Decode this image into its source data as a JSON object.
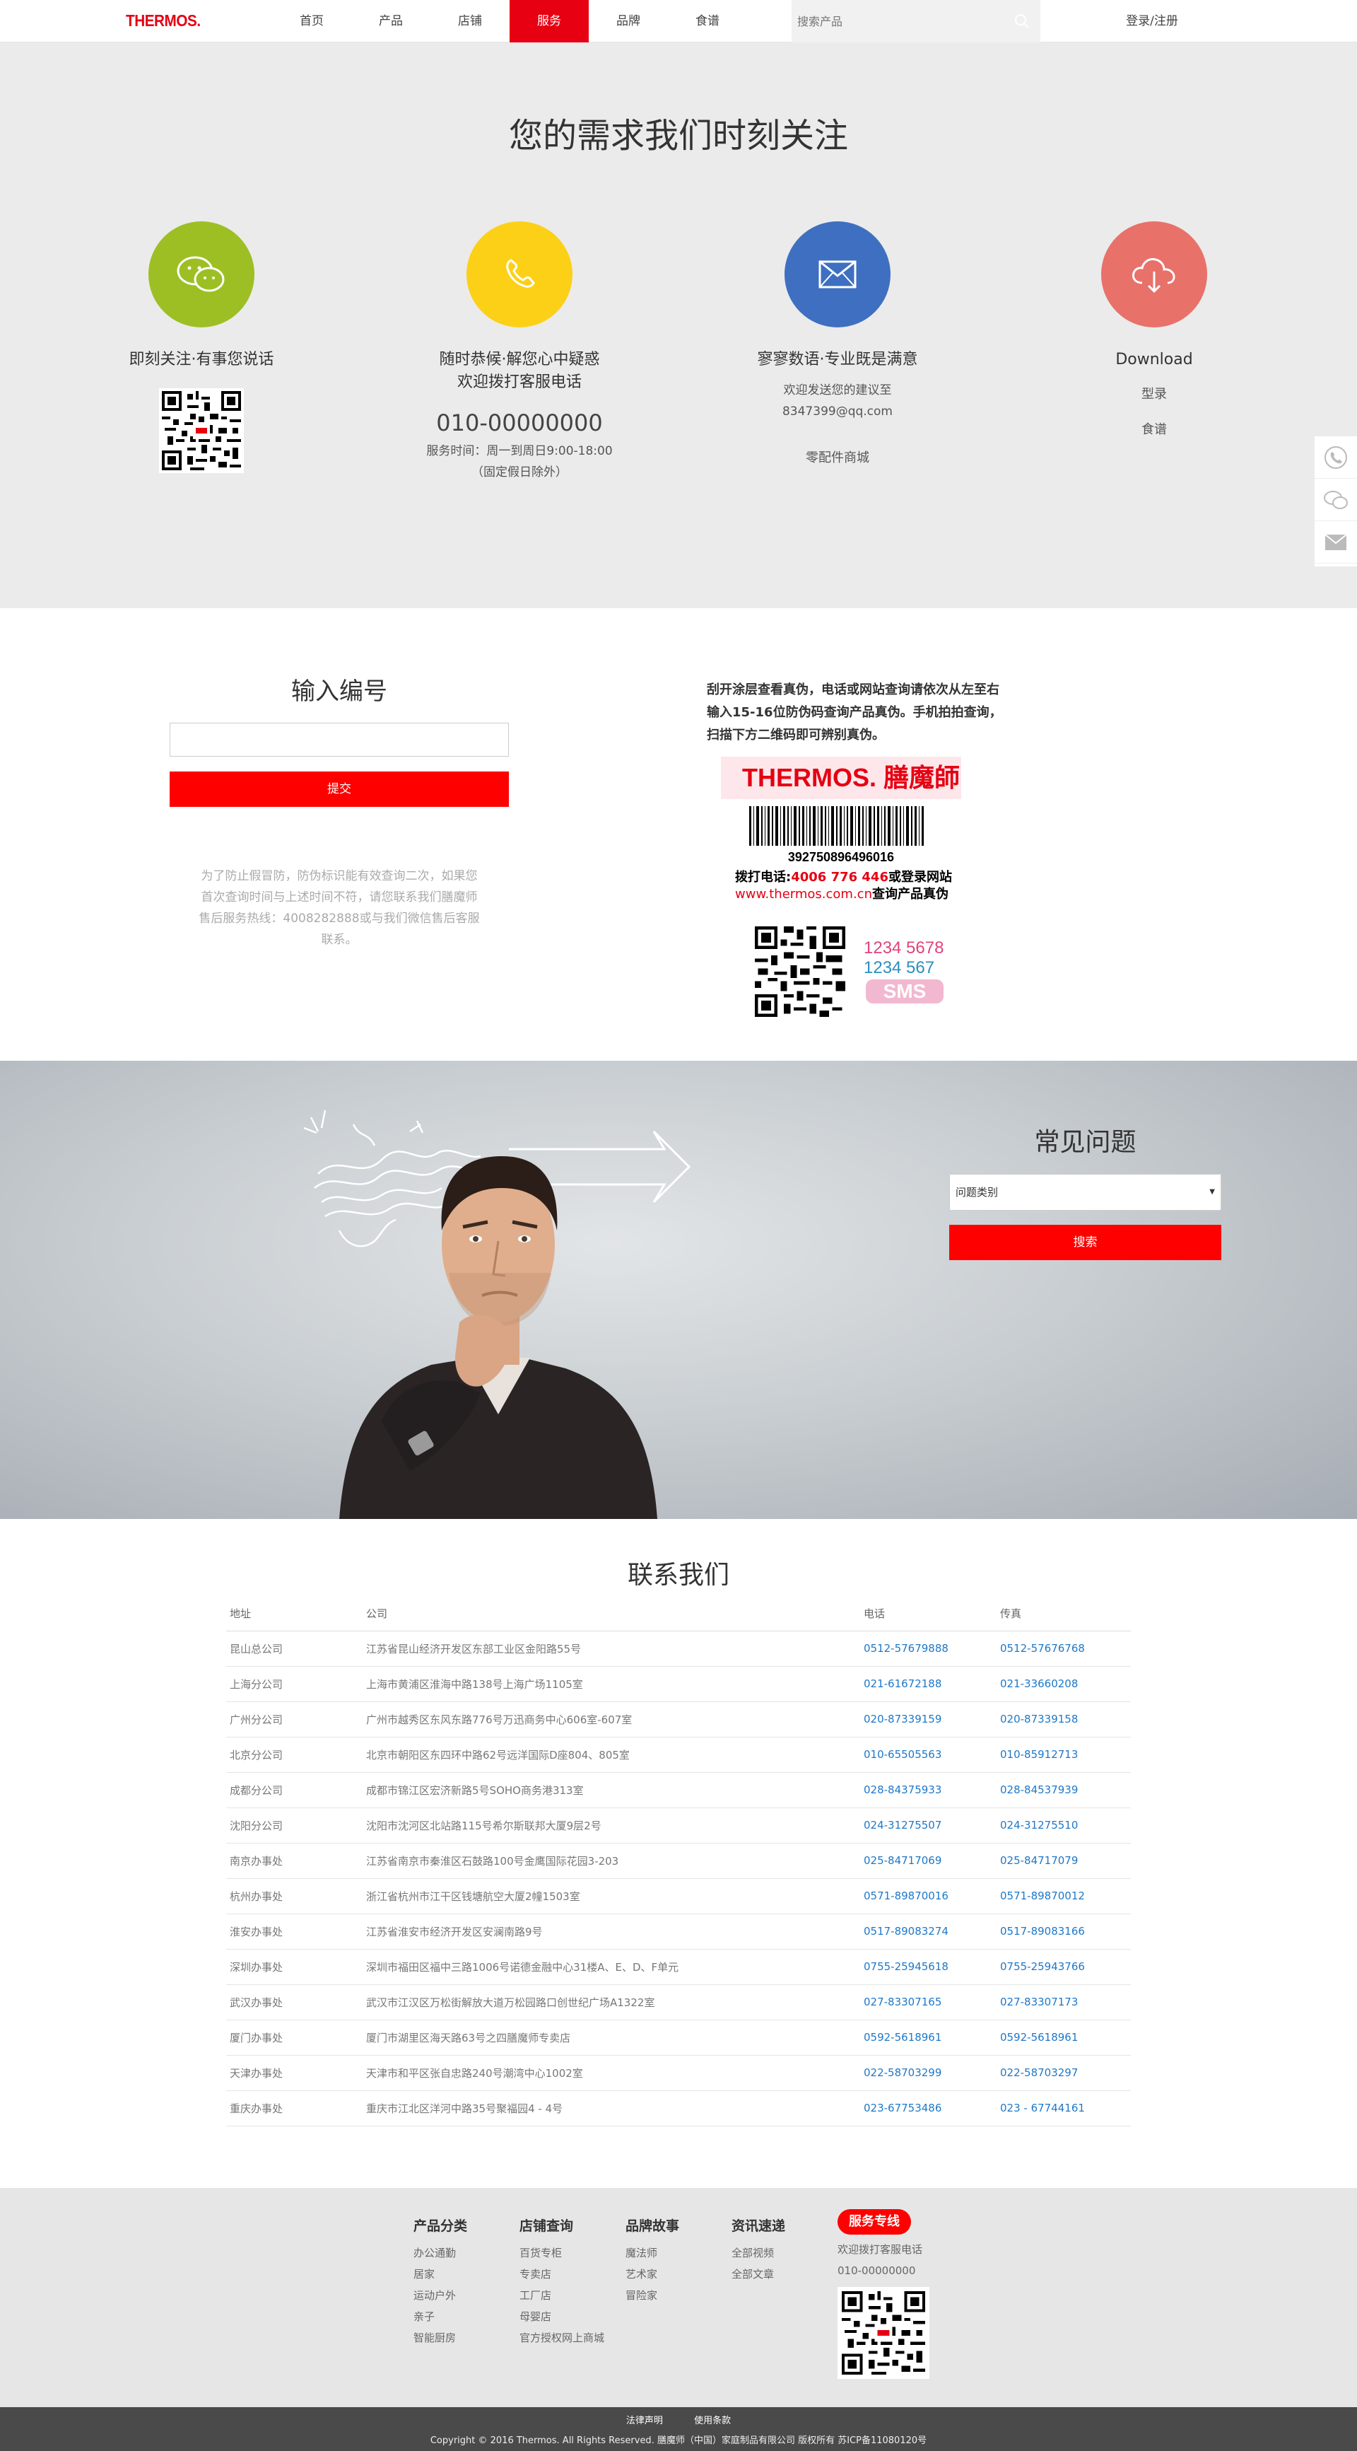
{
  "header": {
    "logo": "THERMOS.",
    "nav": [
      "首页",
      "产品",
      "店铺",
      "服务",
      "品牌",
      "食谱"
    ],
    "active_nav": "服务",
    "search_placeholder": "搜索产品",
    "login_label": "登录/注册"
  },
  "service": {
    "title": "您的需求我们时刻关注",
    "wechat": {
      "heading": "即刻关注·有事您说话",
      "color": "#9dbf24"
    },
    "phone": {
      "heading_line1": "随时恭候·解您心中疑惑",
      "heading_line2": "欢迎拨打客服电话",
      "number": "010-00000000",
      "hours": "服务时间：周一到周日9:00-18:00",
      "hours_note": "（固定假日除外）",
      "color": "#fdd018"
    },
    "mail": {
      "heading": "寥寥数语·专业既是满意",
      "line1": "欢迎发送您的建议至",
      "email": "8347399@qq.com",
      "parts": "零配件商城",
      "color": "#3e6fc1"
    },
    "download": {
      "heading": "Download",
      "link1": "型录",
      "link2": "食谱",
      "color": "#e8716a"
    }
  },
  "verify": {
    "title": "输入编号",
    "input_value": "",
    "submit_label": "提交",
    "note": "为了防止假冒防，防伪标识能有效查询二次，如果您首次查询时间与上述时间不符，请您联系我们膳魔师售后服务热线：4008282888或与我们微信售后客服联系。",
    "instructions": "刮开涂层查看真伪，电话或网站查询请依次从左至右输入15-16位防伪码查询产品真伪。手机拍拍查询，扫描下方二维码即可辨别真伪。",
    "label": {
      "brand": "THERMOS. 膳魔師",
      "barcode_number": "392750896496016",
      "phone_text_prefix": "拨打电话:",
      "phone_number": "4006 776 446",
      "phone_text_suffix": "或登录网站",
      "website": "www.thermos.com.cn",
      "website_suffix": "查询产品真伪",
      "sms_num1": "1234 5678",
      "sms_num2": "1234 567",
      "sms": "SMS"
    }
  },
  "faq": {
    "title": "常见问题",
    "select_value": "问题类别",
    "button_label": "搜索"
  },
  "contact": {
    "title": "联系我们",
    "headers": [
      "地址",
      "公司",
      "电话",
      "传真"
    ],
    "rows": [
      [
        "昆山总公司",
        "江苏省昆山经济开发区东部工业区金阳路55号",
        "0512-57679888",
        "0512-57676768"
      ],
      [
        "上海分公司",
        "上海市黄浦区淮海中路138号上海广场1105室",
        "021-61672188",
        "021-33660208"
      ],
      [
        "广州分公司",
        "广州市越秀区东风东路776号万迅商务中心606室-607室",
        "020-87339159",
        "020-87339158"
      ],
      [
        "北京分公司",
        "北京市朝阳区东四环中路62号远洋国际D座804、805室",
        "010-65505563",
        "010-85912713"
      ],
      [
        "成都分公司",
        "成都市锦江区宏济新路5号SOHO商务港313室",
        "028-84375933",
        "028-84537939"
      ],
      [
        "沈阳分公司",
        "沈阳市沈河区北站路115号希尔斯联邦大厦9层2号",
        "024-31275507",
        "024-31275510"
      ],
      [
        "南京办事处",
        "江苏省南京市秦淮区石鼓路100号金鹰国际花园3-203",
        "025-84717069",
        "025-84717079"
      ],
      [
        "杭州办事处",
        "浙江省杭州市江干区钱塘航空大厦2幢1503室",
        "0571-89870016",
        "0571-89870012"
      ],
      [
        "淮安办事处",
        "江苏省淮安市经济开发区安澜南路9号",
        "0517-89083274",
        "0517-89083166"
      ],
      [
        "深圳办事处",
        "深圳市福田区福中三路1006号诺德金融中心31楼A、E、D、F单元",
        "0755-25945618",
        "0755-25943766"
      ],
      [
        "武汉办事处",
        "武汉市江汉区万松街解放大道万松园路口创世纪广场A1322室",
        "027-83307165",
        "027-83307173"
      ],
      [
        "厦门办事处",
        "厦门市湖里区海天路63号之四膳魔师专卖店",
        "0592-5618961",
        "0592-5618961"
      ],
      [
        "天津办事处",
        "天津市和平区张自忠路240号潮湾中心1002室",
        "022-58703299",
        "022-58703297"
      ],
      [
        "重庆办事处",
        "重庆市江北区洋河中路35号聚福园4 - 4号",
        "023-67753486",
        "023 - 67744161"
      ]
    ]
  },
  "footer": {
    "col1": {
      "heading": "产品分类",
      "links": [
        "办公通勤",
        "居家",
        "运动户外",
        "亲子",
        "智能厨房"
      ]
    },
    "col2": {
      "heading": "店铺查询",
      "links": [
        "百货专柜",
        "专卖店",
        "工厂店",
        "母婴店",
        "官方授权网上商城"
      ]
    },
    "col3": {
      "heading": "品牌故事",
      "links": [
        "魔法师",
        "艺术家",
        "冒险家"
      ]
    },
    "col4": {
      "heading": "资讯速递",
      "links": [
        "全部视频",
        "全部文章"
      ]
    },
    "hotline": {
      "badge": "服务专线",
      "line1": "欢迎拨打客服电话",
      "number": "010-00000000"
    },
    "bottom_links": [
      "法律声明",
      "使用条款"
    ],
    "copyright": "Copyright © 2016 Thermos. All Rights Reserved. 膳魔师（中国）家庭制品有限公司 版权所有 苏ICP备11080120号"
  },
  "colors": {
    "brand_red": "#e60012",
    "button_red": "#ff0000",
    "link_blue": "#1e78c8"
  }
}
